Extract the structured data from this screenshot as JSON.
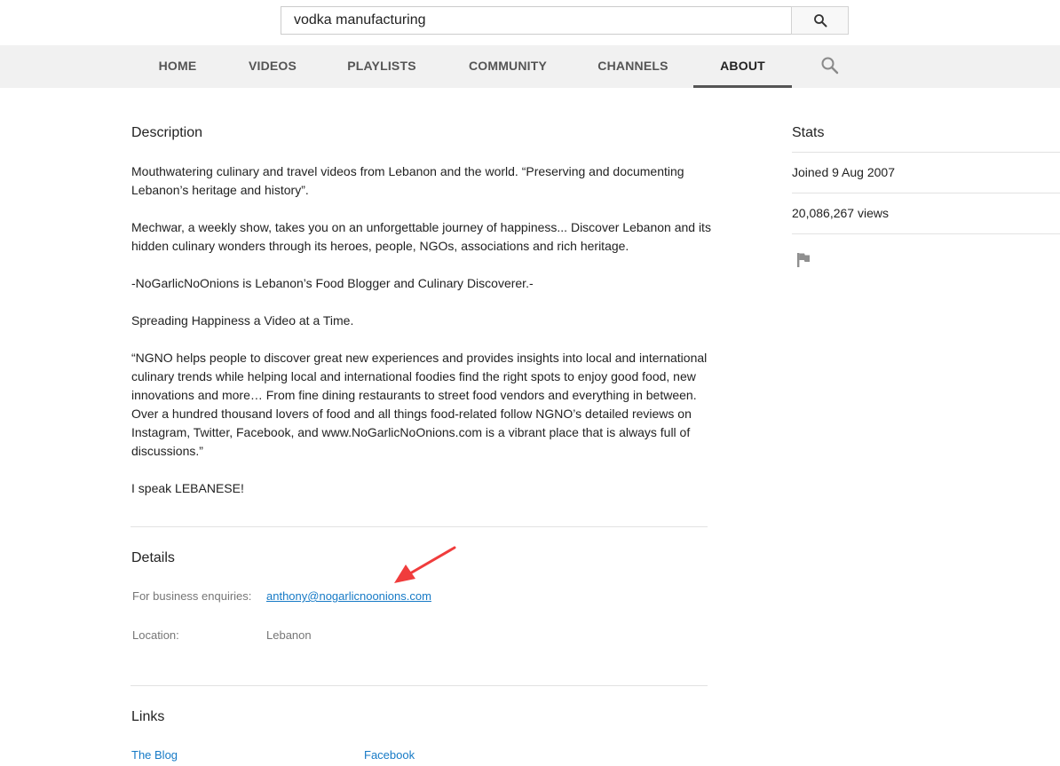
{
  "search": {
    "query": "vodka manufacturing",
    "button_icon": "search-icon"
  },
  "tabs": [
    {
      "label": "HOME",
      "active": false
    },
    {
      "label": "VIDEOS",
      "active": false
    },
    {
      "label": "PLAYLISTS",
      "active": false
    },
    {
      "label": "COMMUNITY",
      "active": false
    },
    {
      "label": "CHANNELS",
      "active": false
    },
    {
      "label": "ABOUT",
      "active": true
    }
  ],
  "tab_search_icon": "search-icon",
  "description": {
    "heading": "Description",
    "paragraphs": [
      "Mouthwatering culinary and travel videos from Lebanon and the world. “Preserving and documenting Lebanon’s heritage and history”.",
      "Mechwar, a weekly show, takes you on an unforgettable journey of happiness... Discover Lebanon and its hidden culinary wonders through its heroes, people, NGOs, associations and rich heritage.",
      "-NoGarlicNoOnions is Lebanon’s Food Blogger and Culinary Discoverer.-",
      "Spreading Happiness a Video at a Time.",
      "“NGNO helps people to discover great new experiences and provides insights into local and international culinary trends while helping local and international foodies find the right spots to enjoy good food, new innovations and more… From fine dining restaurants to street food vendors and everything in between. Over a hundred thousand lovers of food and all things food-related follow NGNO’s detailed reviews on Instagram, Twitter, Facebook, and www.NoGarlicNoOnions.com is a vibrant place that is always full of discussions.”",
      "I speak LEBANESE!"
    ]
  },
  "details": {
    "heading": "Details",
    "business_label": "For business enquiries:",
    "business_email": "anthony@nogarlicnoonions.com",
    "location_label": "Location:",
    "location_value": "Lebanon"
  },
  "links": {
    "heading": "Links",
    "items": [
      "The Blog",
      "Facebook"
    ]
  },
  "stats": {
    "heading": "Stats",
    "joined": "Joined 9 Aug 2007",
    "views": "20,086,267 views",
    "flag_icon": "flag-icon"
  },
  "annotation": {
    "arrow_color": "#f03c3c"
  }
}
